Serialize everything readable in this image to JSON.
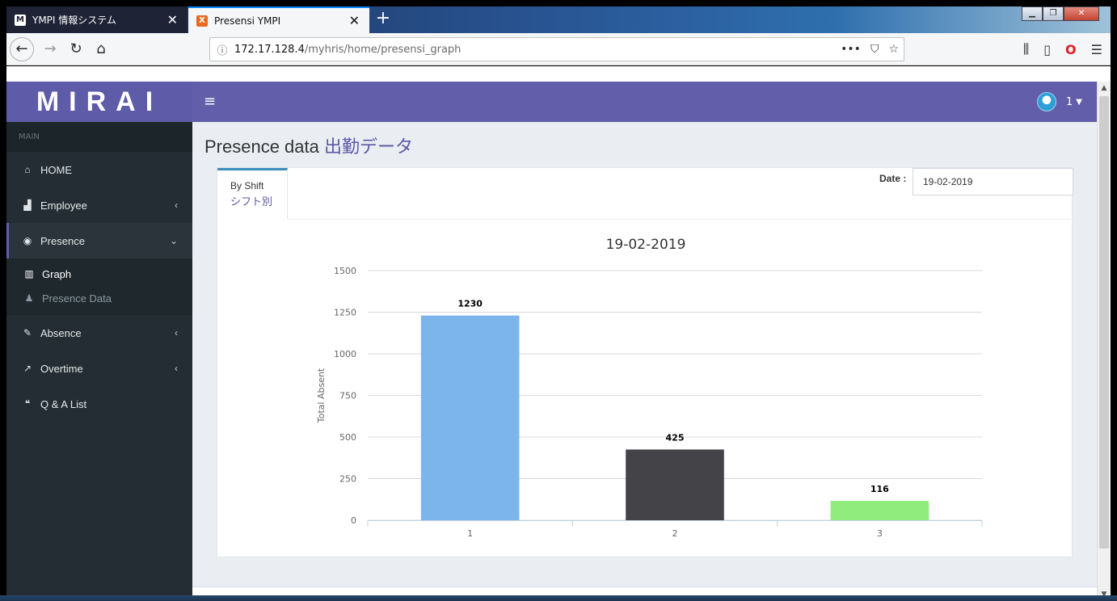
{
  "browser": {
    "tabs": [
      {
        "title": "YMPI 情報システム",
        "favicon": "M"
      },
      {
        "title": "Presensi YMPI",
        "favicon": "X"
      }
    ],
    "new_tab_label": "+",
    "close_glyph": "✕",
    "url_host": "172.17.128.4",
    "url_path": "/myhris/home/presensi_graph",
    "url_actions": [
      "•••",
      "pocket-icon",
      "star-icon"
    ],
    "window_controls": [
      "minimize",
      "restore",
      "close"
    ]
  },
  "app": {
    "logo": "MIRAI",
    "user_label": "1",
    "accent": "#635ea9"
  },
  "sidebar": {
    "section_label": "MAIN",
    "items": [
      {
        "label": "HOME",
        "icon": "home-icon"
      },
      {
        "label": "Employee",
        "icon": "factory-icon",
        "expandable": true
      },
      {
        "label": "Presence",
        "icon": "eye-icon",
        "expandable": true,
        "expanded": true
      },
      {
        "label": "Absence",
        "icon": "edit-icon",
        "expandable": true
      },
      {
        "label": "Overtime",
        "icon": "line-chart-icon",
        "expandable": true
      },
      {
        "label": "Q & A List",
        "icon": "comments-icon"
      }
    ],
    "presence_sub": [
      {
        "label": "Graph",
        "icon": "bar-chart-icon",
        "active": true
      },
      {
        "label": "Presence Data",
        "icon": "person-icon"
      }
    ]
  },
  "page": {
    "title": "Presence data",
    "title_jp": "出勤データ",
    "tab_label": "By Shift",
    "tab_label_jp": "シフト別",
    "date_label": "Date :",
    "date_value": "19-02-2019"
  },
  "chart_data": {
    "type": "bar",
    "title": "19-02-2019",
    "categories": [
      "1",
      "2",
      "3"
    ],
    "values": [
      1230,
      425,
      116
    ],
    "colors": [
      "#7cb5ec",
      "#434348",
      "#90ed7d"
    ],
    "ylabel": "Total Absent",
    "xlabel": "",
    "ylim": [
      0,
      1500
    ],
    "yticks": [
      0,
      250,
      500,
      750,
      1000,
      1250,
      1500
    ],
    "grid": true,
    "data_labels": true
  }
}
